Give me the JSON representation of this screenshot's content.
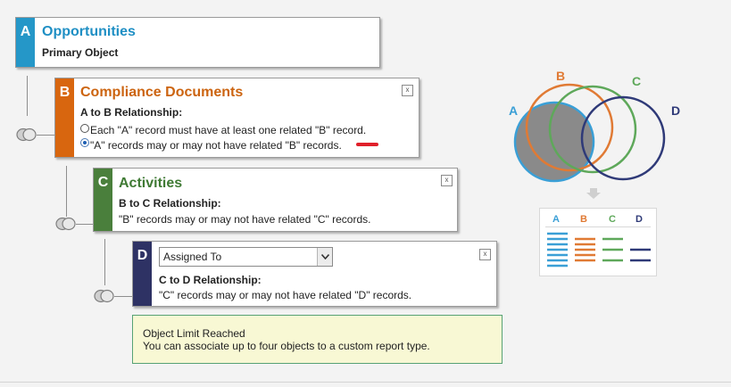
{
  "objects": {
    "a": {
      "letter": "A",
      "title": "Opportunities",
      "subtitle": "Primary Object",
      "color": "#2597c8",
      "title_color": "#1f8fc4"
    },
    "b": {
      "letter": "B",
      "title": "Compliance Documents",
      "relationship_label": "A to B Relationship:",
      "option1": "Each \"A\" record must have at least one related \"B\" record.",
      "option2": "\"A\" records may or may not have related \"B\" records.",
      "selected_option": 2,
      "color": "#d8660f",
      "title_color": "#cc6410"
    },
    "c": {
      "letter": "C",
      "title": "Activities",
      "relationship_label": "B to C Relationship:",
      "relationship_text": "\"B\" records may or may not have related \"C\" records.",
      "color": "#4a7f3c",
      "title_color": "#3f7a34"
    },
    "d": {
      "letter": "D",
      "select_value": "Assigned To",
      "relationship_label": "C to D Relationship:",
      "relationship_text": "\"C\" records may or may not have related \"D\" records.",
      "color": "#2e3264"
    }
  },
  "close_label": "x",
  "notice": {
    "title": "Object Limit Reached",
    "message": "You can associate up to four objects to a custom report type."
  },
  "venn": {
    "circle_labels": [
      "A",
      "B",
      "C",
      "D"
    ],
    "columns": [
      "A",
      "B",
      "C",
      "D"
    ],
    "colors": {
      "a": "#3a9fd6",
      "b": "#e07a34",
      "c": "#5ea85a",
      "d": "#2f3a78",
      "fill": "#8a8a8a"
    }
  }
}
